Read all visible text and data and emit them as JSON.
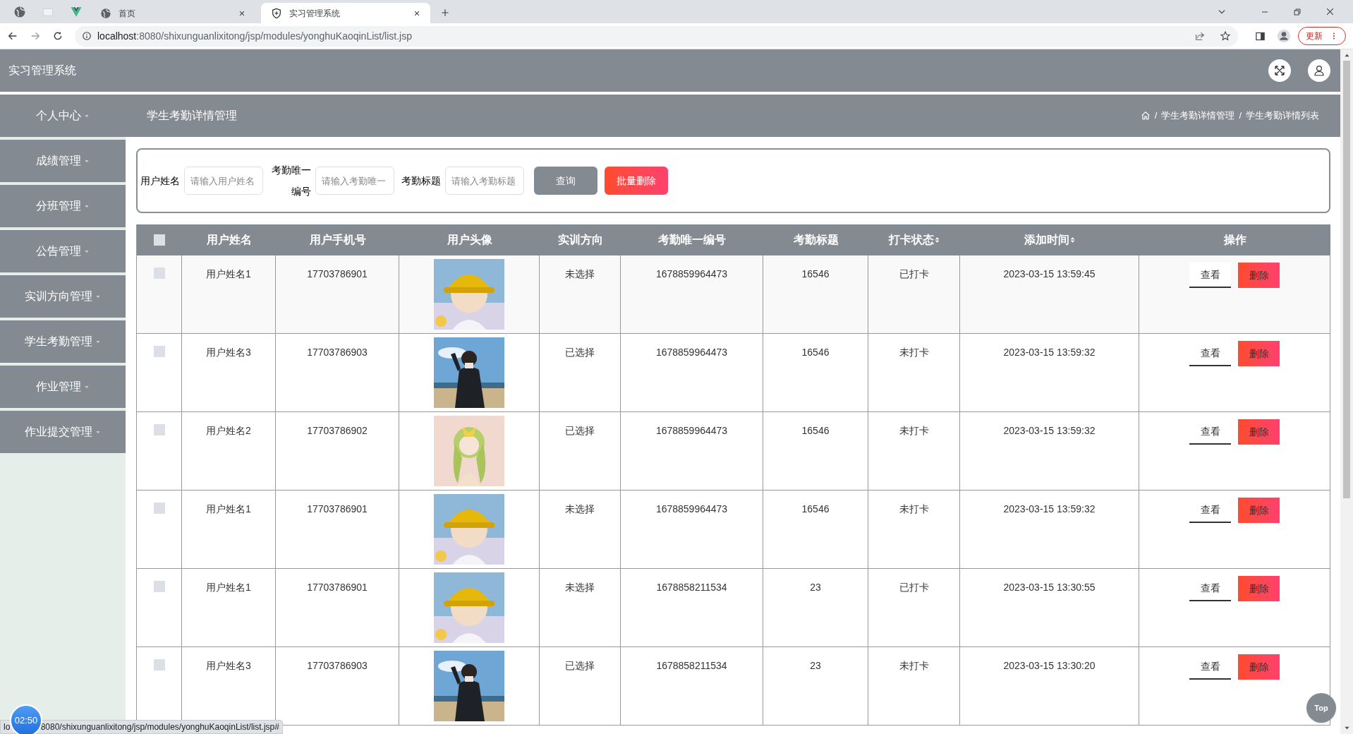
{
  "browser": {
    "tabs": [
      {
        "kind": "icon",
        "selected": false
      },
      {
        "kind": "icon",
        "selected": false
      },
      {
        "kind": "icon",
        "selected": false
      },
      {
        "kind": "page",
        "label": "首页",
        "selected": false
      },
      {
        "kind": "page",
        "label": "实习管理系统",
        "selected": true
      }
    ],
    "address": {
      "host": "localhost",
      "rest": ":8080/shixunguanlixitong/jsp/modules/yonghuKaoqinList/list.jsp"
    },
    "update_button": "更新"
  },
  "app": {
    "title": "实习管理系统"
  },
  "sidebar": {
    "items": [
      {
        "label": "个人中心"
      },
      {
        "label": "成绩管理"
      },
      {
        "label": "分班管理"
      },
      {
        "label": "公告管理"
      },
      {
        "label": "实训方向管理"
      },
      {
        "label": "学生考勤管理"
      },
      {
        "label": "作业管理"
      },
      {
        "label": "作业提交管理"
      }
    ]
  },
  "page_title": "学生考勤详情管理",
  "breadcrumb": [
    {
      "separator": "/",
      "label": "学生考勤详情管理"
    },
    {
      "separator": "/",
      "label": "学生考勤详情列表"
    }
  ],
  "search": {
    "fields": [
      {
        "label": "用户姓名",
        "placeholder": "请输入用户姓名"
      },
      {
        "label": "考勤唯一编号",
        "placeholder": "请输入考勤唯一"
      },
      {
        "label": "考勤标题",
        "placeholder": "请输入考勤标题"
      }
    ],
    "buttons": [
      {
        "kind": "query",
        "label": "查询"
      },
      {
        "kind": "danger",
        "label": "批量删除"
      }
    ]
  },
  "table": {
    "select_all": {
      "checked": false
    },
    "columns": [
      {
        "label": "用户姓名",
        "sortable": false
      },
      {
        "label": "用户手机号",
        "sortable": false
      },
      {
        "label": "用户头像",
        "sortable": false
      },
      {
        "label": "实训方向",
        "sortable": false
      },
      {
        "label": "考勤唯一编号",
        "sortable": false
      },
      {
        "label": "考勤标题",
        "sortable": false
      },
      {
        "label": "打卡状态",
        "sortable": true
      },
      {
        "label": "添加时间",
        "sortable": true
      },
      {
        "label": "操作",
        "sortable": false
      }
    ],
    "rows": [
      {
        "checked": false,
        "name": "用户姓名1",
        "phone": "17703786901",
        "avatar": {
          "kind": "picture"
        },
        "direction": "未选择",
        "code": "1678859964473",
        "title": "16546",
        "status": "已打卡",
        "time": "2023-03-15 13:59:45",
        "actions": [
          "查看",
          "删除"
        ]
      },
      {
        "checked": false,
        "name": "用户姓名3",
        "phone": "17703786903",
        "avatar": {
          "kind": "picture"
        },
        "direction": "已选择",
        "code": "1678859964473",
        "title": "16546",
        "status": "未打卡",
        "time": "2023-03-15 13:59:32",
        "actions": [
          "查看",
          "删除"
        ]
      },
      {
        "checked": false,
        "name": "用户姓名2",
        "phone": "17703786902",
        "avatar": {
          "kind": "picture"
        },
        "direction": "已选择",
        "code": "1678859964473",
        "title": "16546",
        "status": "未打卡",
        "time": "2023-03-15 13:59:32",
        "actions": [
          "查看",
          "删除"
        ]
      },
      {
        "checked": false,
        "name": "用户姓名1",
        "phone": "17703786901",
        "avatar": {
          "kind": "picture"
        },
        "direction": "未选择",
        "code": "1678859964473",
        "title": "16546",
        "status": "未打卡",
        "time": "2023-03-15 13:59:32",
        "actions": [
          "查看",
          "删除"
        ]
      },
      {
        "checked": false,
        "name": "用户姓名1",
        "phone": "17703786901",
        "avatar": {
          "kind": "picture"
        },
        "direction": "未选择",
        "code": "1678858211534",
        "title": "23",
        "status": "已打卡",
        "time": "2023-03-15 13:30:55",
        "actions": [
          "查看",
          "删除"
        ]
      },
      {
        "checked": false,
        "name": "用户姓名3",
        "phone": "17703786903",
        "avatar": {
          "kind": "picture"
        },
        "direction": "已选择",
        "code": "1678858211534",
        "title": "23",
        "status": "未打卡",
        "time": "2023-03-15 13:30:20",
        "actions": [
          "查看",
          "删除"
        ]
      }
    ]
  },
  "overlays": {
    "timer": "02:50",
    "status_url": [
      "lo",
      ".8080/shixunguanlixitong/jsp/modules/yonghuKaoqinList/list.jsp#"
    ],
    "top_button": "Top"
  }
}
